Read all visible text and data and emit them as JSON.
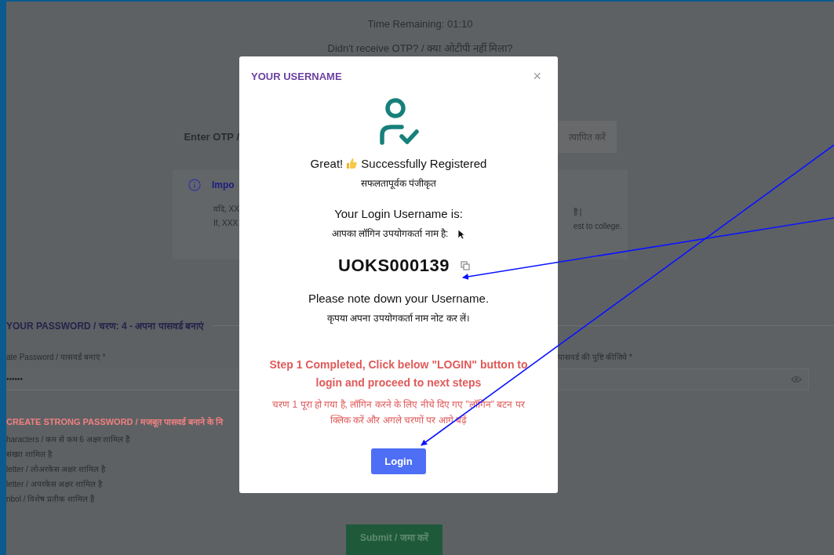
{
  "background": {
    "timer": "Time Remaining: 01:10",
    "resend": "Didn't receive OTP? / क्या ओटीपी नहीं मिला?",
    "otp_label": "Enter OTP /",
    "verify_button": "त्यापित करें",
    "notice": {
      "title": "Impo",
      "lines_left": [
        "यदि, XX",
        "If, XXX"
      ],
      "lines_right": [
        "हैं |",
        "est to college."
      ]
    },
    "section_heading": "YOUR PASSWORD / चरण: 4 - अपना पासवर्ड बनाएं",
    "password_label": "ate Password / पासवर्ड बनाएं *",
    "password_value": "••••••",
    "confirm_label": "पासवर्ड की पुष्टि कीजिये *",
    "rules_heading": "CREATE STRONG PASSWORD / मजबूत पासवर्ड बनाने के नि",
    "rules": [
      "haracters / कम से कम 6 अक्षर शामिल हैं",
      "संख्या शामिल है",
      "letter / लोअरकेस अक्षर शामिल है",
      "letter / अपरकेस अक्षर शामिल है",
      "nbol / विशेष प्रतीक शामिल हैं"
    ],
    "submit_button": "Submit / जमा करें"
  },
  "modal": {
    "title": "YOUR USERNAME",
    "close": "×",
    "great": "Great!",
    "registered": "Successfully Registered",
    "registered_hi": "सफलतापूर्वक पंजीकृत",
    "username_label": "Your Login Username is:",
    "username_label_hi": "आपका लॉगिन उपयोगकर्ता नाम है:",
    "username": "UOKS000139",
    "note": "Please note down your Username.",
    "note_hi": "कृपया अपना उपयोगकर्ता नाम नोट कर लें।",
    "step_message": "Step 1 Completed, Click below \"LOGIN\" button to login and proceed to next steps",
    "step_message_hi": "चरण 1 पूरा हो गया है, लॉगिन करने के लिए नीचे दिए गए \"लॉगिन\" बटन पर क्लिक करें और अगले चरणों पर आगे बढ़ें",
    "login_button": "Login"
  }
}
